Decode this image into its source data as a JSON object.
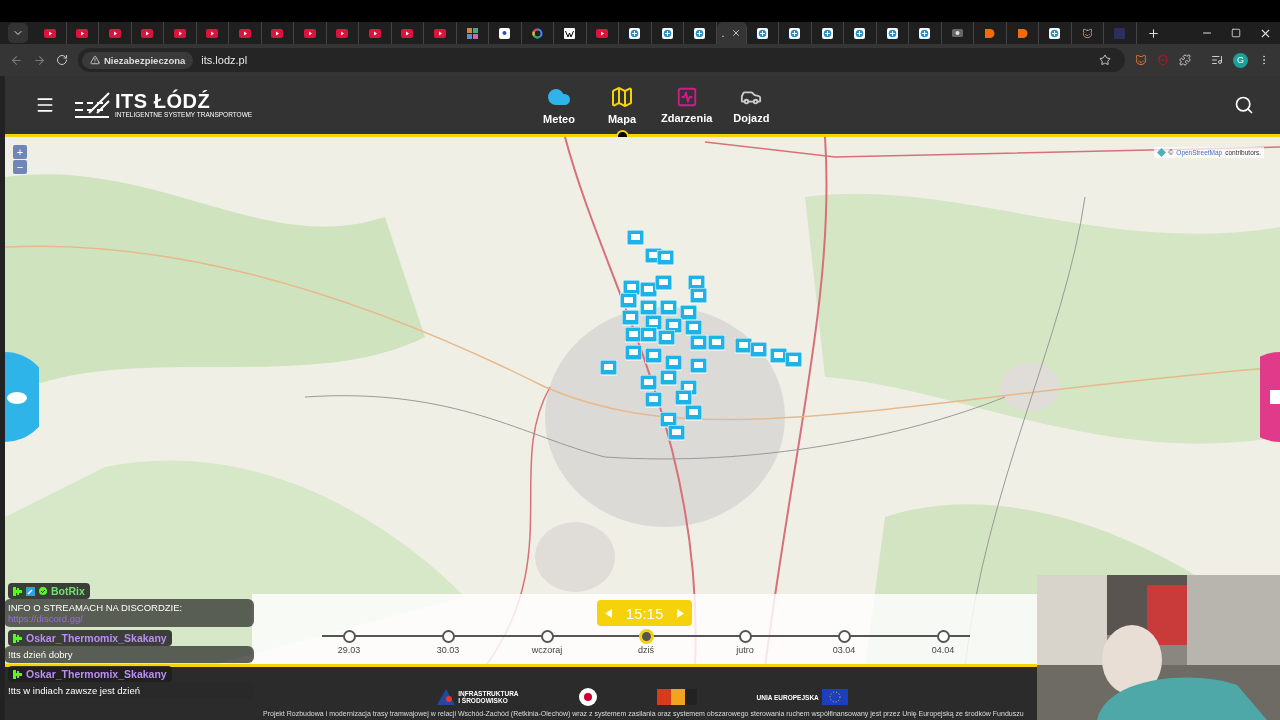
{
  "browser": {
    "tabs": [
      {
        "kind": "youtube",
        "selected": false
      },
      {
        "kind": "youtube",
        "selected": false
      },
      {
        "kind": "youtube",
        "selected": false
      },
      {
        "kind": "youtube",
        "selected": false
      },
      {
        "kind": "youtube",
        "selected": false
      },
      {
        "kind": "youtube",
        "selected": false
      },
      {
        "kind": "youtube",
        "selected": false
      },
      {
        "kind": "youtube",
        "selected": false
      },
      {
        "kind": "youtube",
        "selected": false
      },
      {
        "kind": "youtube",
        "selected": false
      },
      {
        "kind": "youtube",
        "selected": false
      },
      {
        "kind": "youtube",
        "selected": false
      },
      {
        "kind": "youtube",
        "selected": false
      },
      {
        "kind": "mosaic",
        "selected": false
      },
      {
        "kind": "doc",
        "selected": false
      },
      {
        "kind": "google",
        "selected": false
      },
      {
        "kind": "wiki",
        "selected": false
      },
      {
        "kind": "youtube",
        "selected": false
      },
      {
        "kind": "site",
        "selected": false
      },
      {
        "kind": "site",
        "selected": false
      },
      {
        "kind": "site",
        "selected": false
      },
      {
        "kind": "blank",
        "selected": true,
        "title": "."
      },
      {
        "kind": "site",
        "selected": false
      },
      {
        "kind": "site",
        "selected": false
      },
      {
        "kind": "site",
        "selected": false
      },
      {
        "kind": "site",
        "selected": false
      },
      {
        "kind": "site",
        "selected": false
      },
      {
        "kind": "site",
        "selected": false
      },
      {
        "kind": "camera",
        "selected": false
      },
      {
        "kind": "orange",
        "selected": false
      },
      {
        "kind": "orange",
        "selected": false
      },
      {
        "kind": "site",
        "selected": false
      },
      {
        "kind": "figure",
        "selected": false
      },
      {
        "kind": "dark",
        "selected": false
      }
    ],
    "security_label": "Niezabezpieczona",
    "url": "its.lodz.pl",
    "profile": "G"
  },
  "site": {
    "logo": {
      "title": "ITS ŁÓDŹ",
      "subtitle": "INTELIGENTNE SYSTEMY TRANSPORTOWE"
    },
    "nav": [
      {
        "kind": "meteo",
        "label": "Meteo",
        "selected": false
      },
      {
        "kind": "map",
        "label": "Mapa",
        "selected": true
      },
      {
        "kind": "events",
        "label": "Zdarzenia",
        "selected": false
      },
      {
        "kind": "route",
        "label": "Dojazd",
        "selected": false
      }
    ],
    "map": {
      "zoom_in": "+",
      "zoom_out": "−",
      "attribution": {
        "prefix": "©",
        "link": "OpenStreetMap",
        "suffix": "contributors."
      }
    },
    "timeline": {
      "time": "15:15",
      "days": [
        {
          "label": "29.03",
          "selected": false
        },
        {
          "label": "30.03",
          "selected": false
        },
        {
          "label": "wczoraj",
          "selected": false
        },
        {
          "label": "dziś",
          "selected": true
        },
        {
          "label": "jutro",
          "selected": false
        },
        {
          "label": "03.04",
          "selected": false
        },
        {
          "label": "04.04",
          "selected": false
        }
      ]
    },
    "footer": {
      "logos": [
        {
          "title": "INFRASTRUKTURA",
          "subtitle": "I ŚRODOWISKO"
        },
        {
          "title": "UNIA EUROPEJSKA"
        }
      ],
      "text": "Projekt Rozbudowa i modernizacja trasy tramwajowej w relacji Wschód-Zachód (Retkinia-Olechów) wraz z systemem zasilania oraz systemem obszarowego sterowania ruchem współfinansowany jest przez Unię Europejską ze środków Funduszu"
    }
  },
  "stream": {
    "chat": [
      {
        "user": "BotRix",
        "color": "#6fe36f",
        "kind": "bot",
        "text": "INFO O STREAMACH NA DISCORDZIE:",
        "link": "https://discord.gg/"
      },
      {
        "user": "Oskar_Thermomix_Skakany",
        "color": "#b98ef2",
        "kind": "user",
        "text": "!tts dzień dobry"
      },
      {
        "user": "Oskar_Thermomix_Skakany",
        "color": "#b98ef2",
        "kind": "user",
        "text": "!tts w indiach zawsze jest dzień"
      }
    ]
  }
}
